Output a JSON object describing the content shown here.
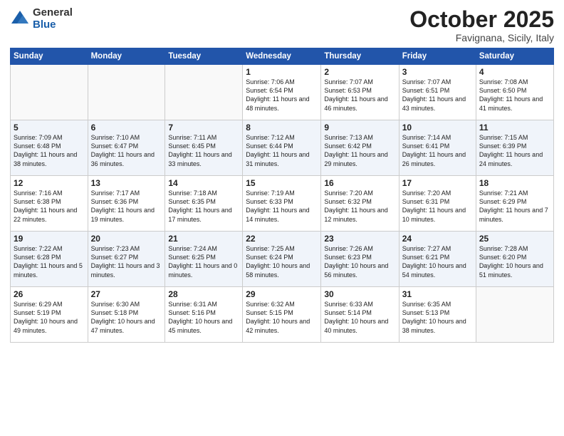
{
  "header": {
    "logo_general": "General",
    "logo_blue": "Blue",
    "month": "October 2025",
    "location": "Favignana, Sicily, Italy"
  },
  "days_of_week": [
    "Sunday",
    "Monday",
    "Tuesday",
    "Wednesday",
    "Thursday",
    "Friday",
    "Saturday"
  ],
  "weeks": [
    [
      {
        "day": "",
        "info": ""
      },
      {
        "day": "",
        "info": ""
      },
      {
        "day": "",
        "info": ""
      },
      {
        "day": "1",
        "info": "Sunrise: 7:06 AM\nSunset: 6:54 PM\nDaylight: 11 hours\nand 48 minutes."
      },
      {
        "day": "2",
        "info": "Sunrise: 7:07 AM\nSunset: 6:53 PM\nDaylight: 11 hours\nand 46 minutes."
      },
      {
        "day": "3",
        "info": "Sunrise: 7:07 AM\nSunset: 6:51 PM\nDaylight: 11 hours\nand 43 minutes."
      },
      {
        "day": "4",
        "info": "Sunrise: 7:08 AM\nSunset: 6:50 PM\nDaylight: 11 hours\nand 41 minutes."
      }
    ],
    [
      {
        "day": "5",
        "info": "Sunrise: 7:09 AM\nSunset: 6:48 PM\nDaylight: 11 hours\nand 38 minutes."
      },
      {
        "day": "6",
        "info": "Sunrise: 7:10 AM\nSunset: 6:47 PM\nDaylight: 11 hours\nand 36 minutes."
      },
      {
        "day": "7",
        "info": "Sunrise: 7:11 AM\nSunset: 6:45 PM\nDaylight: 11 hours\nand 33 minutes."
      },
      {
        "day": "8",
        "info": "Sunrise: 7:12 AM\nSunset: 6:44 PM\nDaylight: 11 hours\nand 31 minutes."
      },
      {
        "day": "9",
        "info": "Sunrise: 7:13 AM\nSunset: 6:42 PM\nDaylight: 11 hours\nand 29 minutes."
      },
      {
        "day": "10",
        "info": "Sunrise: 7:14 AM\nSunset: 6:41 PM\nDaylight: 11 hours\nand 26 minutes."
      },
      {
        "day": "11",
        "info": "Sunrise: 7:15 AM\nSunset: 6:39 PM\nDaylight: 11 hours\nand 24 minutes."
      }
    ],
    [
      {
        "day": "12",
        "info": "Sunrise: 7:16 AM\nSunset: 6:38 PM\nDaylight: 11 hours\nand 22 minutes."
      },
      {
        "day": "13",
        "info": "Sunrise: 7:17 AM\nSunset: 6:36 PM\nDaylight: 11 hours\nand 19 minutes."
      },
      {
        "day": "14",
        "info": "Sunrise: 7:18 AM\nSunset: 6:35 PM\nDaylight: 11 hours\nand 17 minutes."
      },
      {
        "day": "15",
        "info": "Sunrise: 7:19 AM\nSunset: 6:33 PM\nDaylight: 11 hours\nand 14 minutes."
      },
      {
        "day": "16",
        "info": "Sunrise: 7:20 AM\nSunset: 6:32 PM\nDaylight: 11 hours\nand 12 minutes."
      },
      {
        "day": "17",
        "info": "Sunrise: 7:20 AM\nSunset: 6:31 PM\nDaylight: 11 hours\nand 10 minutes."
      },
      {
        "day": "18",
        "info": "Sunrise: 7:21 AM\nSunset: 6:29 PM\nDaylight: 11 hours\nand 7 minutes."
      }
    ],
    [
      {
        "day": "19",
        "info": "Sunrise: 7:22 AM\nSunset: 6:28 PM\nDaylight: 11 hours\nand 5 minutes."
      },
      {
        "day": "20",
        "info": "Sunrise: 7:23 AM\nSunset: 6:27 PM\nDaylight: 11 hours\nand 3 minutes."
      },
      {
        "day": "21",
        "info": "Sunrise: 7:24 AM\nSunset: 6:25 PM\nDaylight: 11 hours\nand 0 minutes."
      },
      {
        "day": "22",
        "info": "Sunrise: 7:25 AM\nSunset: 6:24 PM\nDaylight: 10 hours\nand 58 minutes."
      },
      {
        "day": "23",
        "info": "Sunrise: 7:26 AM\nSunset: 6:23 PM\nDaylight: 10 hours\nand 56 minutes."
      },
      {
        "day": "24",
        "info": "Sunrise: 7:27 AM\nSunset: 6:21 PM\nDaylight: 10 hours\nand 54 minutes."
      },
      {
        "day": "25",
        "info": "Sunrise: 7:28 AM\nSunset: 6:20 PM\nDaylight: 10 hours\nand 51 minutes."
      }
    ],
    [
      {
        "day": "26",
        "info": "Sunrise: 6:29 AM\nSunset: 5:19 PM\nDaylight: 10 hours\nand 49 minutes."
      },
      {
        "day": "27",
        "info": "Sunrise: 6:30 AM\nSunset: 5:18 PM\nDaylight: 10 hours\nand 47 minutes."
      },
      {
        "day": "28",
        "info": "Sunrise: 6:31 AM\nSunset: 5:16 PM\nDaylight: 10 hours\nand 45 minutes."
      },
      {
        "day": "29",
        "info": "Sunrise: 6:32 AM\nSunset: 5:15 PM\nDaylight: 10 hours\nand 42 minutes."
      },
      {
        "day": "30",
        "info": "Sunrise: 6:33 AM\nSunset: 5:14 PM\nDaylight: 10 hours\nand 40 minutes."
      },
      {
        "day": "31",
        "info": "Sunrise: 6:35 AM\nSunset: 5:13 PM\nDaylight: 10 hours\nand 38 minutes."
      },
      {
        "day": "",
        "info": ""
      }
    ]
  ]
}
